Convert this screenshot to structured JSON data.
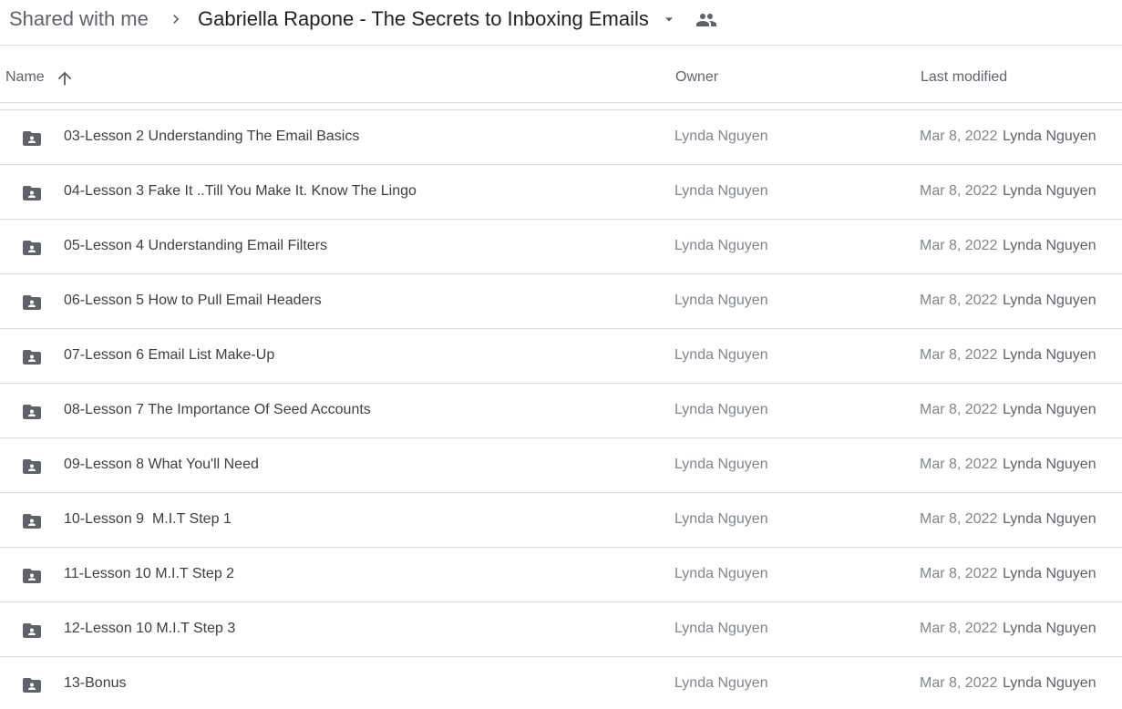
{
  "breadcrumb": {
    "root": "Shared with me",
    "separator_icon": "chevron-right-icon",
    "current": "Gabriella Rapone - The Secrets to Inboxing Emails",
    "dropdown_icon": "caret-down-icon",
    "shared_icon": "people-icon"
  },
  "columns": {
    "name": "Name",
    "sort_icon": "arrow-up-icon",
    "owner": "Owner",
    "last_modified": "Last modified"
  },
  "colors": {
    "icon_gray": "#5f6368",
    "divider": "#dadce0",
    "text_dark": "#3c4043",
    "text_muted": "#80868b"
  },
  "rows": [
    {
      "name": "03-Lesson 2 Understanding The Email Basics",
      "owner": "Lynda Nguyen",
      "date": "Mar 8, 2022",
      "modified_by": "Lynda Nguyen",
      "icon": "shared-folder-icon"
    },
    {
      "name": "04-Lesson 3 Fake It ..Till You Make It. Know The Lingo",
      "owner": "Lynda Nguyen",
      "date": "Mar 8, 2022",
      "modified_by": "Lynda Nguyen",
      "icon": "shared-folder-icon"
    },
    {
      "name": "05-Lesson 4 Understanding Email Filters",
      "owner": "Lynda Nguyen",
      "date": "Mar 8, 2022",
      "modified_by": "Lynda Nguyen",
      "icon": "shared-folder-icon"
    },
    {
      "name": "06-Lesson 5 How to Pull Email Headers",
      "owner": "Lynda Nguyen",
      "date": "Mar 8, 2022",
      "modified_by": "Lynda Nguyen",
      "icon": "shared-folder-icon"
    },
    {
      "name": "07-Lesson 6 Email List Make-Up",
      "owner": "Lynda Nguyen",
      "date": "Mar 8, 2022",
      "modified_by": "Lynda Nguyen",
      "icon": "shared-folder-icon"
    },
    {
      "name": "08-Lesson 7 The Importance Of Seed Accounts",
      "owner": "Lynda Nguyen",
      "date": "Mar 8, 2022",
      "modified_by": "Lynda Nguyen",
      "icon": "shared-folder-icon"
    },
    {
      "name": "09-Lesson 8 What You'll Need",
      "owner": "Lynda Nguyen",
      "date": "Mar 8, 2022",
      "modified_by": "Lynda Nguyen",
      "icon": "shared-folder-icon"
    },
    {
      "name": "10-Lesson 9  M.I.T Step 1",
      "owner": "Lynda Nguyen",
      "date": "Mar 8, 2022",
      "modified_by": "Lynda Nguyen",
      "icon": "shared-folder-icon"
    },
    {
      "name": "11-Lesson 10 M.I.T Step 2",
      "owner": "Lynda Nguyen",
      "date": "Mar 8, 2022",
      "modified_by": "Lynda Nguyen",
      "icon": "shared-folder-icon"
    },
    {
      "name": "12-Lesson 10 M.I.T Step 3",
      "owner": "Lynda Nguyen",
      "date": "Mar 8, 2022",
      "modified_by": "Lynda Nguyen",
      "icon": "shared-folder-icon"
    },
    {
      "name": "13-Bonus",
      "owner": "Lynda Nguyen",
      "date": "Mar 8, 2022",
      "modified_by": "Lynda Nguyen",
      "icon": "shared-folder-icon"
    }
  ]
}
